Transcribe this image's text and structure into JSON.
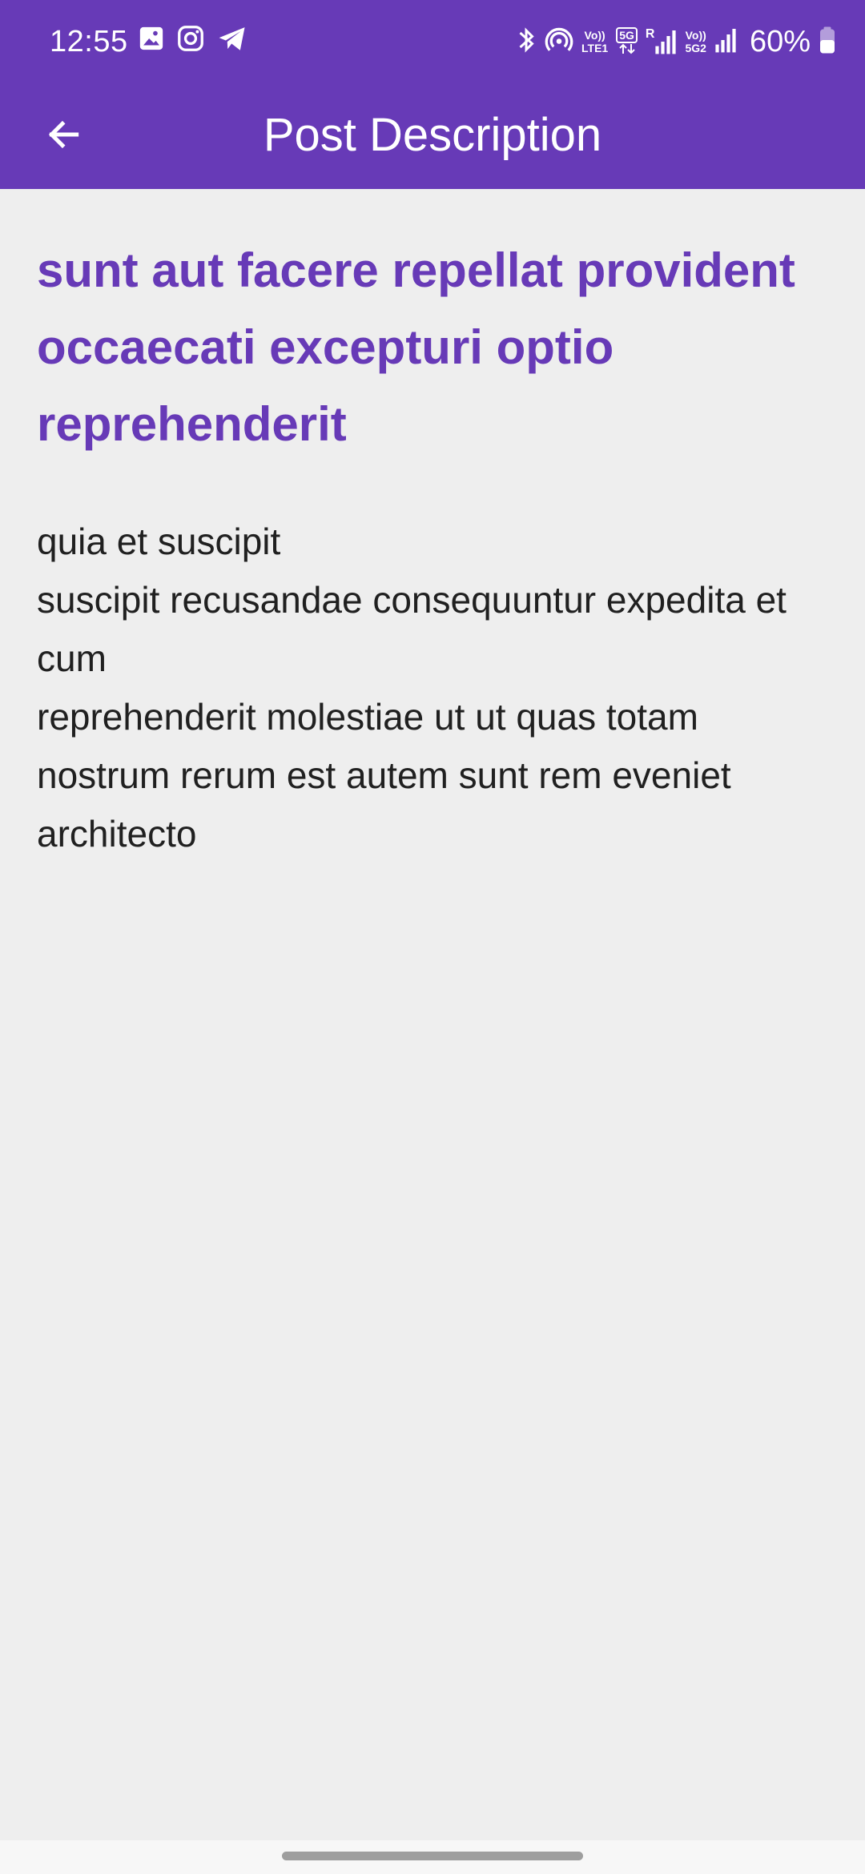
{
  "status_bar": {
    "time": "12:55",
    "left_icons": [
      "gallery-icon",
      "instagram-icon",
      "telegram-icon"
    ],
    "right_icons": [
      "bluetooth-icon",
      "hotspot-icon",
      "volte-icon",
      "5g-icon",
      "signal-icon",
      "vo5g-icon",
      "signal-icon",
      "battery-icon"
    ],
    "volte_top": "Vo))",
    "volte_bottom": "LTE1",
    "badge_5g": "5G",
    "roaming": "R",
    "vo5g_top": "Vo))",
    "vo5g_bottom": "5G2",
    "battery_percent": "60%"
  },
  "app_bar": {
    "title": "Post Description",
    "back_icon": "arrow-left-icon"
  },
  "post": {
    "title": "sunt aut facere repellat provident occaecati excepturi optio reprehenderit",
    "body": "quia et suscipit\nsuscipit recusandae consequuntur expedita et cum\nreprehenderit molestiae ut ut quas totam\nnostrum rerum est autem sunt rem eveniet architecto"
  },
  "colors": {
    "primary": "#673ab7",
    "background": "#eeeeee",
    "body_text": "#202020",
    "on_primary": "#ffffff"
  }
}
